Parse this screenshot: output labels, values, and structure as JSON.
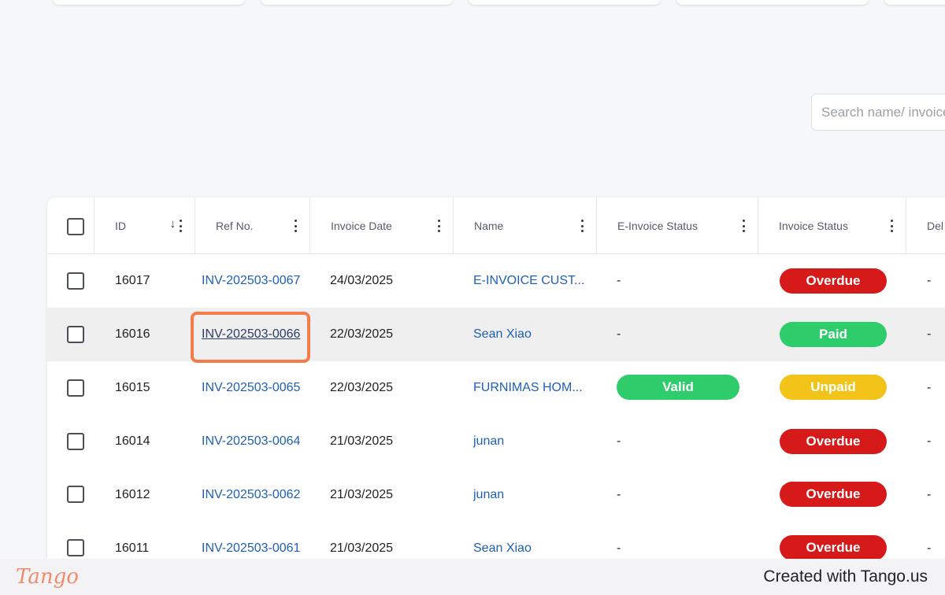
{
  "search": {
    "placeholder": "Search name/ invoice"
  },
  "columns": {
    "id": "ID",
    "ref_no": "Ref No.",
    "invoice_date": "Invoice Date",
    "name": "Name",
    "einvoice_status": "E-Invoice Status",
    "invoice_status": "Invoice Status",
    "partial": "Del"
  },
  "rows": [
    {
      "id": "16017",
      "ref": "INV-202503-0067",
      "date": "24/03/2025",
      "name": "E-INVOICE CUST...",
      "einv": "-",
      "status": "Overdue",
      "del": "-"
    },
    {
      "id": "16016",
      "ref": "INV-202503-0066",
      "date": "22/03/2025",
      "name": "Sean Xiao",
      "einv": "-",
      "status": "Paid",
      "del": "-"
    },
    {
      "id": "16015",
      "ref": "INV-202503-0065",
      "date": "22/03/2025",
      "name": "FURNIMAS HOM...",
      "einv": "Valid",
      "status": "Unpaid",
      "del": "-"
    },
    {
      "id": "16014",
      "ref": "INV-202503-0064",
      "date": "21/03/2025",
      "name": "junan",
      "einv": "-",
      "status": "Overdue",
      "del": "-"
    },
    {
      "id": "16012",
      "ref": "INV-202503-0062",
      "date": "21/03/2025",
      "name": "junan",
      "einv": "-",
      "status": "Overdue",
      "del": "-"
    },
    {
      "id": "16011",
      "ref": "INV-202503-0061",
      "date": "21/03/2025",
      "name": "Sean Xiao",
      "einv": "-",
      "status": "Overdue",
      "del": "-"
    }
  ],
  "colors": {
    "overdue": "#d61a1a",
    "paid": "#2ecc6b",
    "unpaid": "#f2c318",
    "valid": "#2ecc6b",
    "link": "#1f5fb4",
    "highlight": "#f47b4a"
  },
  "footer": {
    "logo": "Tango",
    "credit": "Created with Tango.us"
  }
}
